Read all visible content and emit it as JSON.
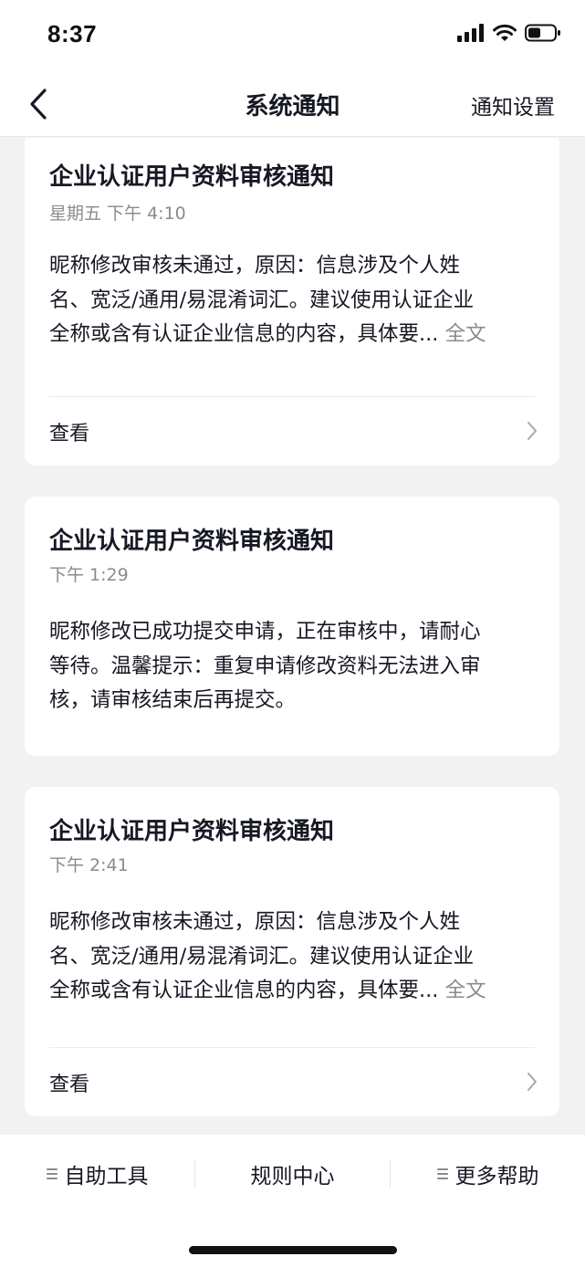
{
  "status_bar": {
    "time": "8:37"
  },
  "nav": {
    "title": "系统通知",
    "action_label": "通知设置"
  },
  "notifications": [
    {
      "title": "企业认证用户资料审核通知",
      "time": "星期五 下午 4:10",
      "body": "昵称修改审核未通过，原因：信息涉及个人姓\n名、宽泛/通用/易混淆词汇。建议使用认证企业\n全称或含有认证企业信息的内容，具体要...",
      "full_text_label": "全文",
      "view_label": "查看"
    },
    {
      "title": "企业认证用户资料审核通知",
      "time": "下午 1:29",
      "body": "昵称修改已成功提交申请，正在审核中，请耐心\n等待。温馨提示：重复申请修改资料无法进入审\n核，请审核结束后再提交。"
    },
    {
      "title": "企业认证用户资料审核通知",
      "time": "下午 2:41",
      "body": "昵称修改审核未通过，原因：信息涉及个人姓\n名、宽泛/通用/易混淆词汇。建议使用认证企业\n全称或含有认证企业信息的内容，具体要...",
      "full_text_label": "全文",
      "view_label": "查看"
    }
  ],
  "bottom_tabs": [
    {
      "label": "自助工具",
      "icon": "menu-icon"
    },
    {
      "label": "规则中心"
    },
    {
      "label": "更多帮助",
      "icon": "menu-icon"
    }
  ]
}
